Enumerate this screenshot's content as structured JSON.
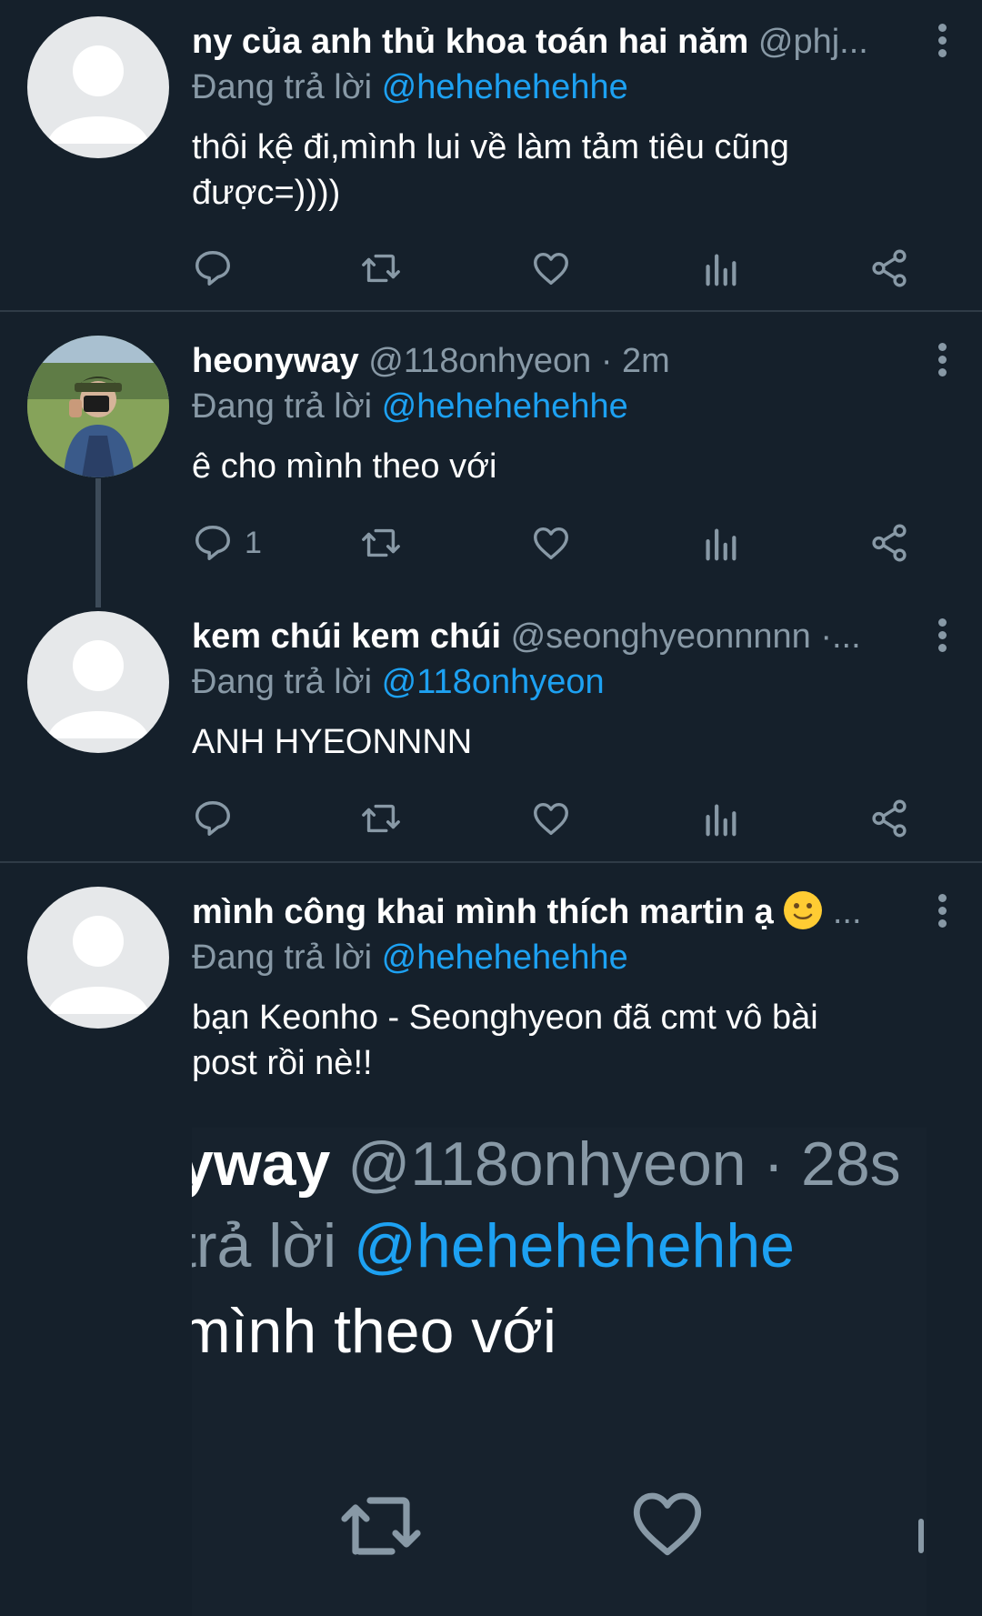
{
  "tweets": [
    {
      "name": "ny của anh thủ khoa toán hai năm",
      "handle": "@phj...",
      "reply_prefix": "Đang trả lời",
      "reply_to": "@hehehehehhe",
      "text": "thôi kệ đi,mình lui về làm tảm tiêu cũng được=))))",
      "reply_count": ""
    },
    {
      "name": "heonyway",
      "handle": "@118onhyeon · 2m",
      "reply_prefix": "Đang trả lời",
      "reply_to": "@hehehehehhe",
      "text": "ê cho mình theo với",
      "reply_count": "1"
    },
    {
      "name": "kem chúi kem chúi",
      "handle": "@seonghyeonnnnn ·...",
      "reply_prefix": "Đang trả lời",
      "reply_to": "@118onhyeon",
      "text": "ANH HYEONNNN",
      "reply_count": ""
    },
    {
      "name": "mình công khai mình thích martin ạ",
      "handle": "...",
      "reply_prefix": "Đang trả lời",
      "reply_to": "@hehehehehhe",
      "text": "bạn Keonho - Seonghyeon đã cmt vô bài post rồi nè!!",
      "reply_count": ""
    }
  ],
  "embedded_screenshot": {
    "line1_name": "yway",
    "line1_handle": "@118onhyeon · 28s",
    "line2_prefix": "trả lời",
    "line2_mention": "@hehehehehhe",
    "line3_text": "mình theo với"
  },
  "icons": [
    "reply-icon",
    "retweet-icon",
    "like-icon",
    "analytics-icon",
    "share-icon",
    "more-icon"
  ],
  "colors": {
    "background": "#15202b",
    "secondary_text": "#8899a6",
    "mention": "#1da1f2",
    "divider": "#2f3b47"
  }
}
